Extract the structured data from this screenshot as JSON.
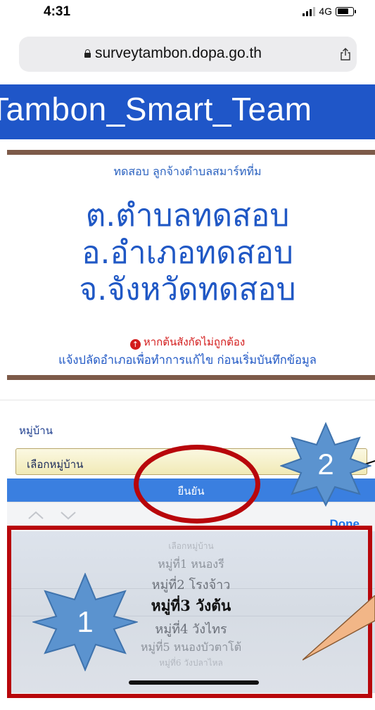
{
  "status_bar": {
    "time": "4:31",
    "network": "4G"
  },
  "browser": {
    "url": "surveytambon.dopa.go.th"
  },
  "page": {
    "banner_title": "Tambon_Smart_Team",
    "subtitle": "ทดสอบ ลูกจ้างตำบลสมาร์ทที่ม",
    "tambon": "ต.ตำบลทดสอบ",
    "amphoe": "อ.อำเภอทดสอบ",
    "changwat": "จ.จังหวัดทดสอบ",
    "warning": "หากต้นสังกัดไม่ถูกต้อง",
    "info": "แจ้งปลัดอำเภอเพื่อทำการแก้ไข ก่อนเริ่มบันทึกข้อมูล"
  },
  "form": {
    "village_label": "หมู่บ้าน",
    "village_select_value": "เลือกหมู่บ้าน",
    "confirm_label": "ยืนยัน"
  },
  "picker": {
    "done_label": "Done",
    "options": [
      "เลือกหมู่บ้าน",
      "หมู่ที่1 หนองรี",
      "หมู่ที่2 โรงจ้าว",
      "หมู่ที่3 วังต้น",
      "หมู่ที่4 วังไทร",
      "หมู่ที่5 หนองบัวตาโต้",
      "หมู่ที่6 วังปลาไหล"
    ],
    "selected_index": 3
  },
  "annotations": {
    "badge_1": "1",
    "badge_2": "2"
  },
  "colors": {
    "banner": "#1f56c8",
    "accent_blue": "#2058c5",
    "warning_red": "#d31b1b",
    "annotation_red": "#b8060b",
    "badge_blue": "#5b93cf"
  }
}
